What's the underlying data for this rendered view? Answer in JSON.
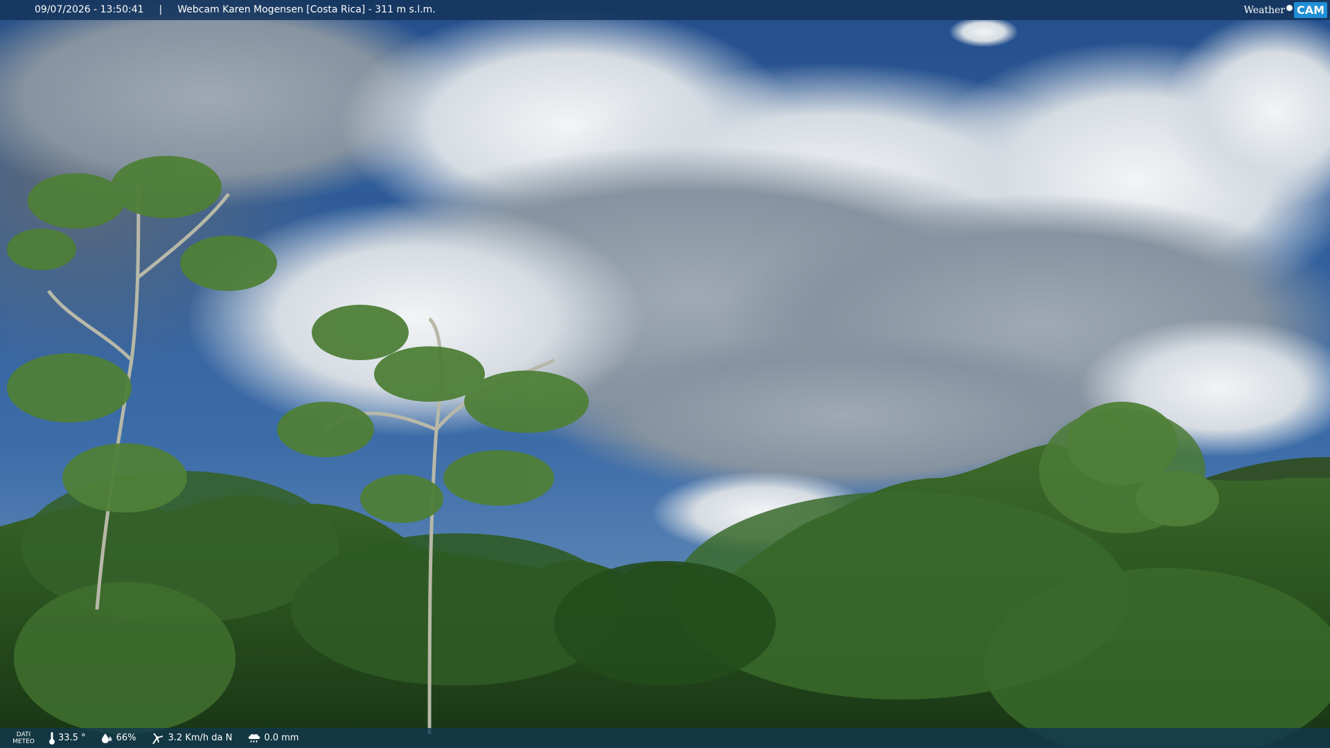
{
  "header": {
    "datetime": "09/07/2026 - 13:50:41",
    "separator": "|",
    "title": "Webcam Karen Mogensen [Costa Rica] - 311 m s.l.m."
  },
  "logo": {
    "weather": "Weather",
    "cam": "CAM"
  },
  "weather_data": {
    "label_line1": "DATI",
    "label_line2": "METEO",
    "temperature": "33.5 °",
    "humidity": "66%",
    "wind": "3.2 Km/h da N",
    "rain": "0.0 mm"
  },
  "icons": {
    "temperature": "thermometer-icon",
    "humidity": "humidity-drop-icon",
    "wind": "wind-icon",
    "rain": "rain-cloud-icon"
  },
  "colors": {
    "top_bar": "#15345c",
    "bottom_bar": "#12384e",
    "logo_accent": "#1f8fd6",
    "sky": "#2f5f9e"
  }
}
